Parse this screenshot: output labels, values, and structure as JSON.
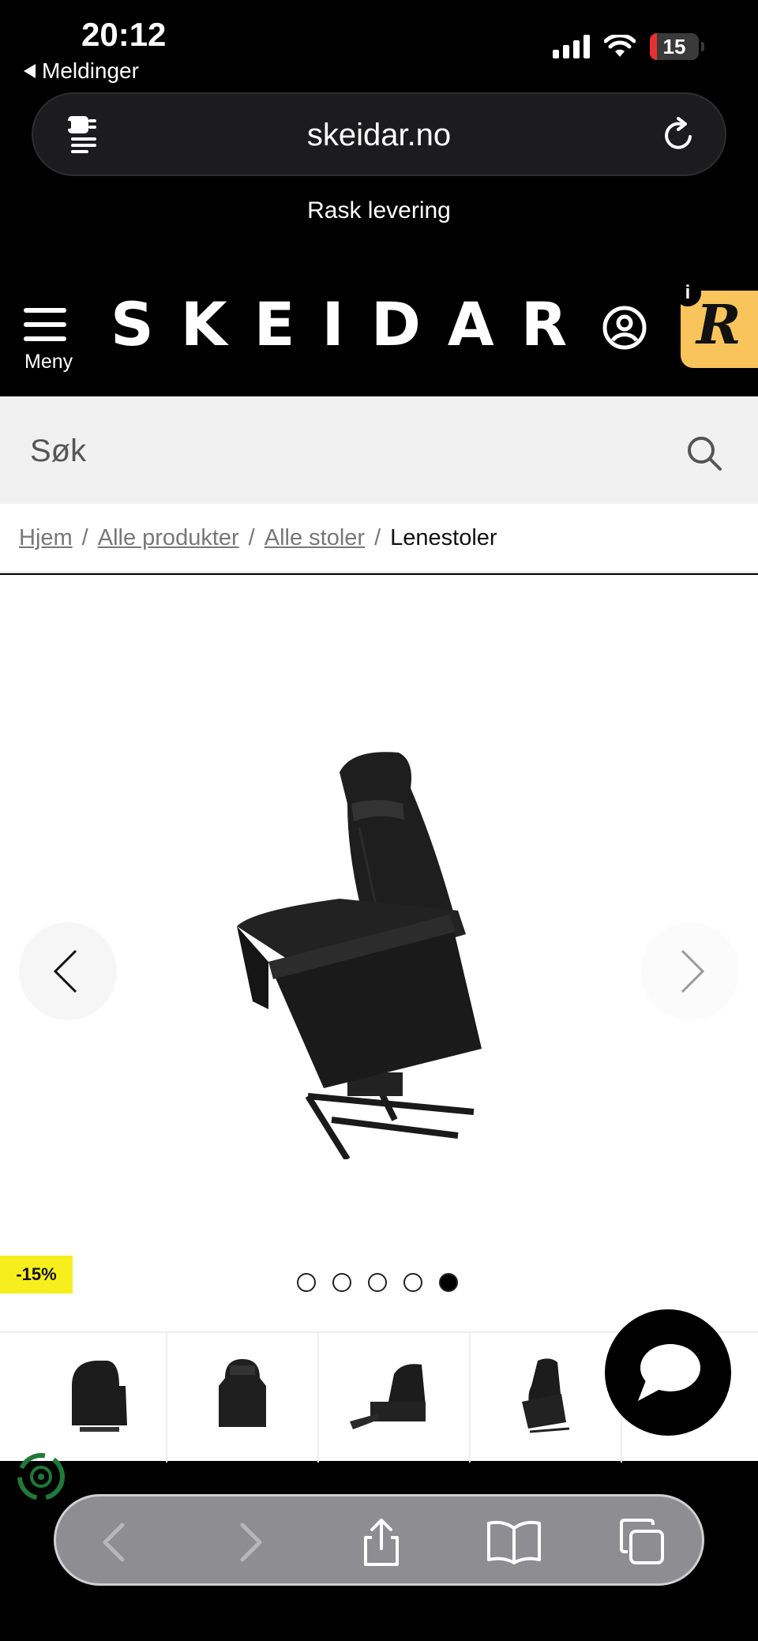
{
  "status_bar": {
    "time": "20:12",
    "back_label": "Meldinger",
    "battery_level": "15",
    "battery_fraction": 0.15,
    "battery_color": "#e5312e",
    "icons": [
      "cellular-signal-icon",
      "wifi-icon",
      "battery-icon"
    ]
  },
  "browser": {
    "host": "skeidar.no",
    "reader_icon": "reader-mode-icon",
    "reload_icon": "reload-icon"
  },
  "promo": {
    "text": "Rask levering"
  },
  "header": {
    "menu_label": "Meny",
    "logo": "SKEIDAR",
    "account_icon": "user-account-icon",
    "badge_letter": "R",
    "badge_info": "i",
    "badge_color": "#f9c45b"
  },
  "search": {
    "placeholder": "Søk",
    "icon": "search-icon"
  },
  "breadcrumb": {
    "items": [
      "Hjem",
      "Alle produkter",
      "Alle stoler"
    ],
    "separator": "/",
    "current": "Lenestoler"
  },
  "gallery": {
    "discount": "-15%",
    "discount_color": "#f7ef1d",
    "image_count": 5,
    "active_image": 5,
    "thumbnail_count": 5
  },
  "chat": {
    "icon": "chat-bubble-icon"
  },
  "toolbar": {
    "icons": [
      "back-icon",
      "forward-icon",
      "share-icon",
      "bookmarks-icon",
      "tabs-icon"
    ]
  }
}
